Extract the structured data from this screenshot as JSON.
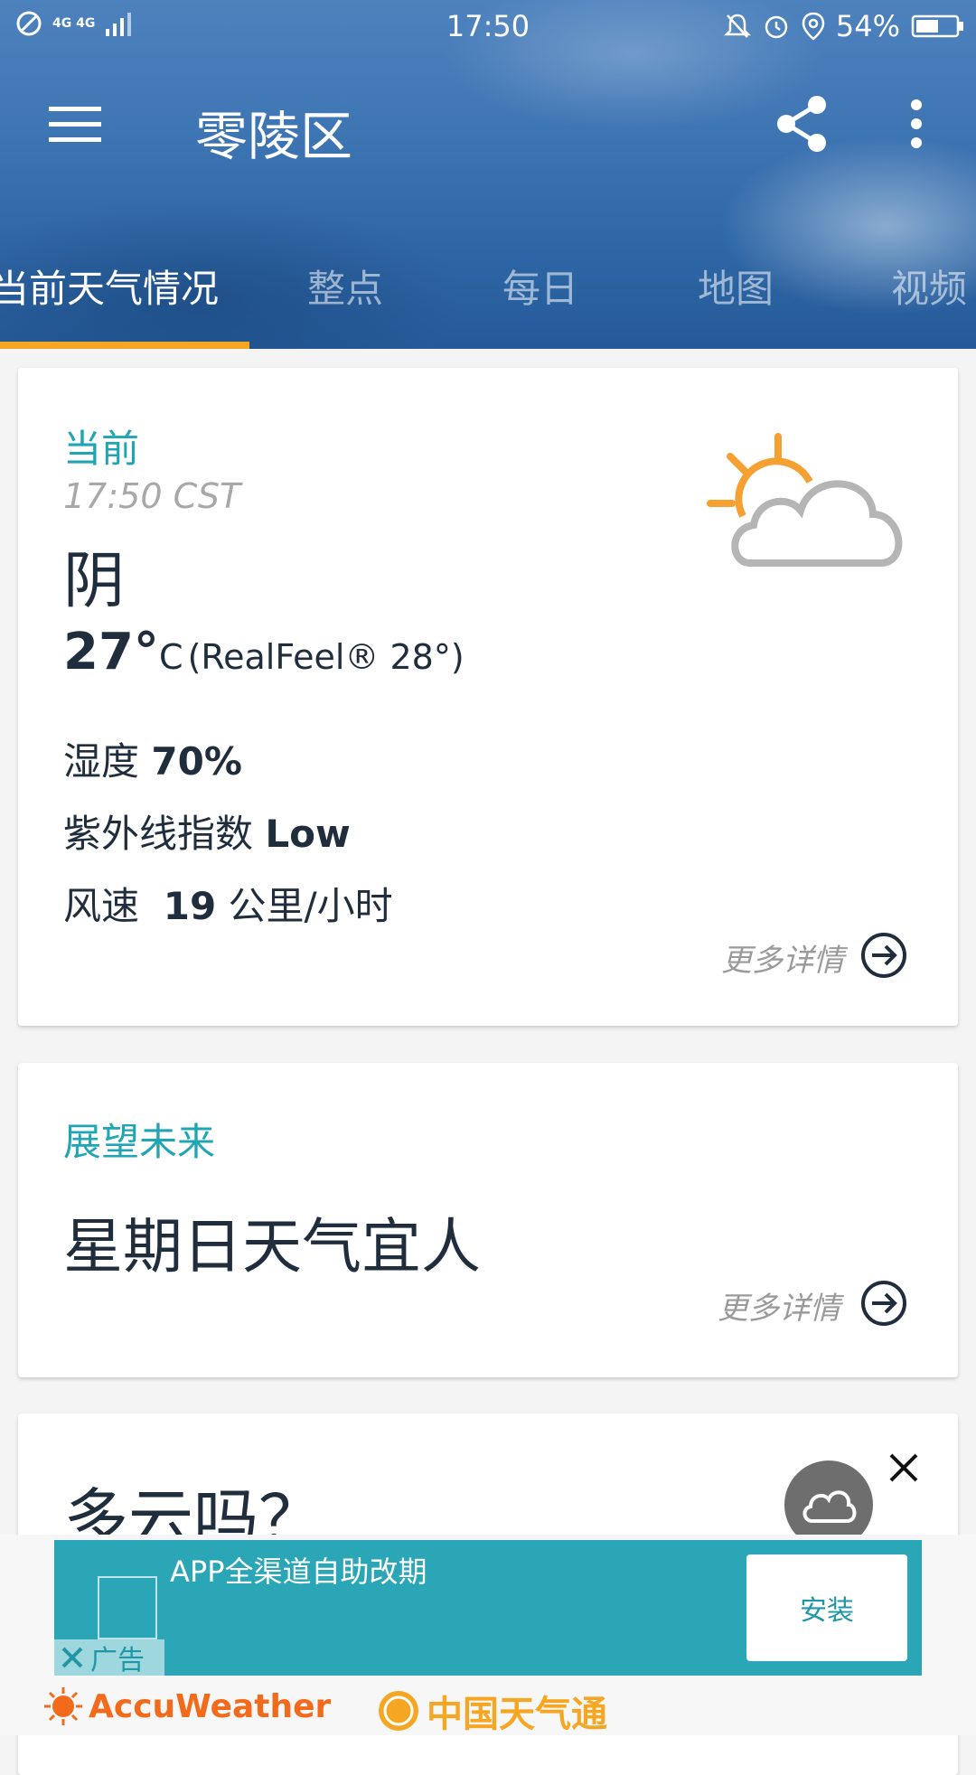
{
  "status_bar": {
    "network": "4G 4G",
    "time": "17:50",
    "battery": "54%"
  },
  "app_bar": {
    "title": "零陵区",
    "icons": [
      "menu-icon",
      "share-icon",
      "more-vert-icon"
    ]
  },
  "tabs": [
    {
      "label": "当前天气情况",
      "active": true
    },
    {
      "label": "整点",
      "active": false
    },
    {
      "label": "每日",
      "active": false
    },
    {
      "label": "地图",
      "active": false
    },
    {
      "label": "视频",
      "active": false
    }
  ],
  "current": {
    "heading": "当前",
    "time": "17:50 CST",
    "condition": "阴",
    "temp": "27°",
    "unit": "C",
    "realfeel": "(RealFeel® 28°)",
    "humidity_label": "湿度",
    "humidity_value": "70%",
    "uv_label": "紫外线指数",
    "uv_value": "Low",
    "wind_label": "风速",
    "wind_value": "19",
    "wind_unit": "公里/小时",
    "more": "更多详情"
  },
  "outlook": {
    "heading": "展望未来",
    "text": "星期日天气宜人",
    "more": "更多详情"
  },
  "cloudy": {
    "text": "多云吗？"
  },
  "ad": {
    "title": "APP全渠道自助改期",
    "install": "安装",
    "label": "广告"
  },
  "brands": {
    "accuweather": "AccuWeather",
    "partner": "中国天气通"
  },
  "colors": {
    "accent": "#1fa5b4",
    "tab_indicator": "#f5a623",
    "brand_orange": "#f26b1d"
  }
}
